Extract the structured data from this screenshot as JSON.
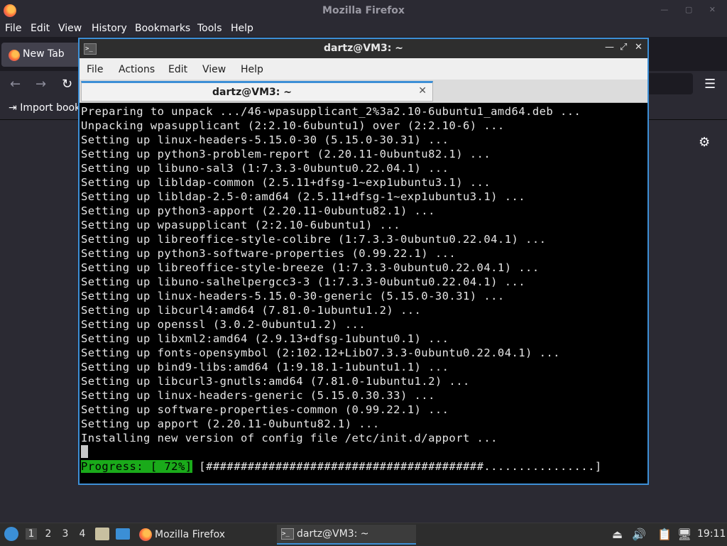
{
  "firefox": {
    "title": "Mozilla Firefox",
    "menu": [
      "File",
      "Edit",
      "View",
      "History",
      "Bookmarks",
      "Tools",
      "Help"
    ],
    "tab_label": "New Tab",
    "import_label": "Import book"
  },
  "terminal": {
    "window_title": "dartz@VM3: ~",
    "menu": [
      "File",
      "Actions",
      "Edit",
      "View",
      "Help"
    ],
    "tab_label": "dartz@VM3: ~",
    "lines": [
      "Preparing to unpack .../46-wpasupplicant_2%3a2.10-6ubuntu1_amd64.deb ...",
      "Unpacking wpasupplicant (2:2.10-6ubuntu1) over (2:2.10-6) ...",
      "Setting up linux-headers-5.15.0-30 (5.15.0-30.31) ...",
      "Setting up python3-problem-report (2.20.11-0ubuntu82.1) ...",
      "Setting up libuno-sal3 (1:7.3.3-0ubuntu0.22.04.1) ...",
      "Setting up libldap-common (2.5.11+dfsg-1~exp1ubuntu3.1) ...",
      "Setting up libldap-2.5-0:amd64 (2.5.11+dfsg-1~exp1ubuntu3.1) ...",
      "Setting up python3-apport (2.20.11-0ubuntu82.1) ...",
      "Setting up wpasupplicant (2:2.10-6ubuntu1) ...",
      "Setting up libreoffice-style-colibre (1:7.3.3-0ubuntu0.22.04.1) ...",
      "Setting up python3-software-properties (0.99.22.1) ...",
      "Setting up libreoffice-style-breeze (1:7.3.3-0ubuntu0.22.04.1) ...",
      "Setting up libuno-salhelpergcc3-3 (1:7.3.3-0ubuntu0.22.04.1) ...",
      "Setting up linux-headers-5.15.0-30-generic (5.15.0-30.31) ...",
      "Setting up libcurl4:amd64 (7.81.0-1ubuntu1.2) ...",
      "Setting up openssl (3.0.2-0ubuntu1.2) ...",
      "Setting up libxml2:amd64 (2.9.13+dfsg-1ubuntu0.1) ...",
      "Setting up fonts-opensymbol (2:102.12+LibO7.3.3-0ubuntu0.22.04.1) ...",
      "Setting up bind9-libs:amd64 (1:9.18.1-1ubuntu1.1) ...",
      "Setting up libcurl3-gnutls:amd64 (7.81.0-1ubuntu1.2) ...",
      "Setting up linux-headers-generic (5.15.0.30.33) ...",
      "Setting up software-properties-common (0.99.22.1) ...",
      "Setting up apport (2.20.11-0ubuntu82.1) ...",
      "Installing new version of config file /etc/init.d/apport ..."
    ],
    "progress_label": "Progress: [ 72%]",
    "progress_bar": " [########################################................]",
    "progress_percent": 72
  },
  "taskbar": {
    "workspaces": [
      "1",
      "2",
      "3",
      "4"
    ],
    "task_firefox": "Mozilla Firefox",
    "task_terminal": "dartz@VM3: ~",
    "clock": "19:11"
  },
  "icons": {
    "firefox": "firefox-icon",
    "terminal": "terminal-icon",
    "settings": "gear-icon",
    "menu": "hamburger-icon"
  }
}
